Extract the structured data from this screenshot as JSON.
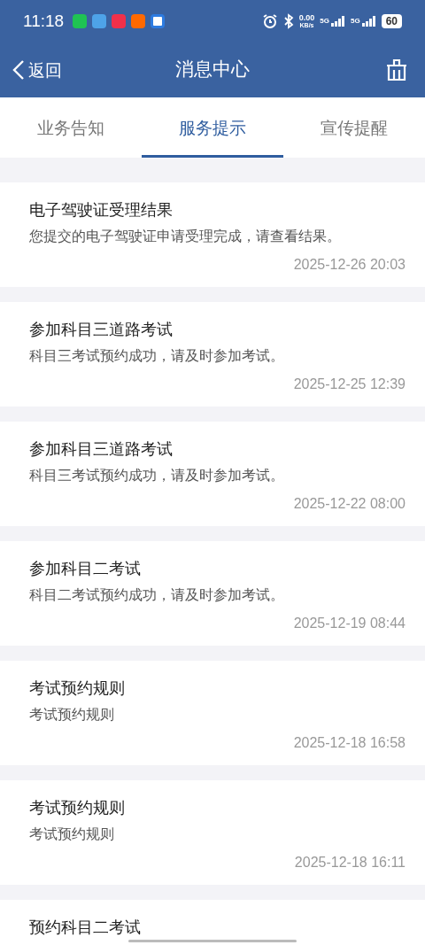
{
  "status_bar": {
    "time": "11:18",
    "net_speed": "0.00",
    "net_unit": "KB/s",
    "signal_1": "5G",
    "signal_2": "5G",
    "battery": "60"
  },
  "header": {
    "back": "返回",
    "title": "消息中心"
  },
  "tabs": [
    {
      "label": "业务告知",
      "selected": false
    },
    {
      "label": "服务提示",
      "selected": true
    },
    {
      "label": "宣传提醒",
      "selected": false
    }
  ],
  "messages": [
    {
      "title": "电子驾驶证受理结果",
      "body": "您提交的电子驾驶证申请受理完成，请查看结果。",
      "time": "2025-12-26 20:03"
    },
    {
      "title": "参加科目三道路考试",
      "body": "科目三考试预约成功，请及时参加考试。",
      "time": "2025-12-25 12:39"
    },
    {
      "title": "参加科目三道路考试",
      "body": "科目三考试预约成功，请及时参加考试。",
      "time": "2025-12-22 08:00"
    },
    {
      "title": "参加科目二考试",
      "body": "科目二考试预约成功，请及时参加考试。",
      "time": "2025-12-19 08:44"
    },
    {
      "title": "考试预约规则",
      "body": "考试预约规则",
      "time": "2025-12-18 16:58"
    },
    {
      "title": "考试预约规则",
      "body": "考试预约规则",
      "time": "2025-12-18 16:11"
    },
    {
      "title": "预约科目二考试"
    }
  ]
}
